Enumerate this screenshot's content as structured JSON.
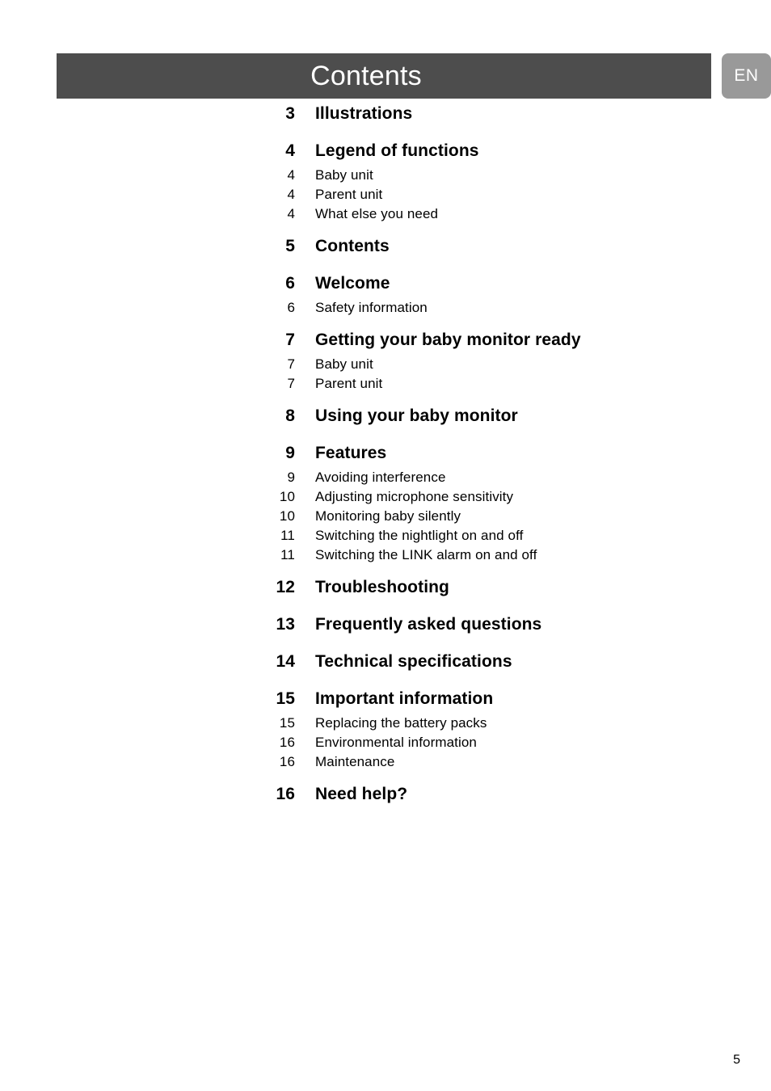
{
  "header": {
    "title": "Contents",
    "language_badge": "EN"
  },
  "toc": {
    "groups": [
      {
        "chapter": {
          "page": "3",
          "label": "Illustrations"
        },
        "subs": []
      },
      {
        "chapter": {
          "page": "4",
          "label": "Legend of functions"
        },
        "subs": [
          {
            "page": "4",
            "label": "Baby unit"
          },
          {
            "page": "4",
            "label": "Parent unit"
          },
          {
            "page": "4",
            "label": "What else you need"
          }
        ]
      },
      {
        "chapter": {
          "page": "5",
          "label": "Contents"
        },
        "subs": []
      },
      {
        "chapter": {
          "page": "6",
          "label": "Welcome"
        },
        "subs": [
          {
            "page": "6",
            "label": "Safety information"
          }
        ]
      },
      {
        "chapter": {
          "page": "7",
          "label": "Getting your baby monitor ready"
        },
        "subs": [
          {
            "page": "7",
            "label": "Baby unit"
          },
          {
            "page": "7",
            "label": "Parent unit"
          }
        ]
      },
      {
        "chapter": {
          "page": "8",
          "label": "Using your baby monitor"
        },
        "subs": []
      },
      {
        "chapter": {
          "page": "9",
          "label": "Features"
        },
        "subs": [
          {
            "page": "9",
            "label": "Avoiding interference"
          },
          {
            "page": "10",
            "label": "Adjusting microphone sensitivity"
          },
          {
            "page": "10",
            "label": "Monitoring baby silently"
          },
          {
            "page": "11",
            "label": "Switching the nightlight on and off"
          },
          {
            "page": "11",
            "label": "Switching the LINK alarm on and off"
          }
        ]
      },
      {
        "chapter": {
          "page": "12",
          "label": "Troubleshooting"
        },
        "subs": []
      },
      {
        "chapter": {
          "page": "13",
          "label": "Frequently asked questions"
        },
        "subs": []
      },
      {
        "chapter": {
          "page": "14",
          "label": "Technical specifications"
        },
        "subs": []
      },
      {
        "chapter": {
          "page": "15",
          "label": "Important information"
        },
        "subs": [
          {
            "page": "15",
            "label": "Replacing the battery packs"
          },
          {
            "page": "16",
            "label": "Environmental information"
          },
          {
            "page": "16",
            "label": "Maintenance"
          }
        ]
      },
      {
        "chapter": {
          "page": "16",
          "label": "Need help?"
        },
        "subs": []
      }
    ]
  },
  "footer": {
    "page_number": "5"
  },
  "colors": {
    "header_bar": "#4d4d4d",
    "language_badge": "#999999",
    "text": "#000000",
    "background": "#ffffff"
  }
}
